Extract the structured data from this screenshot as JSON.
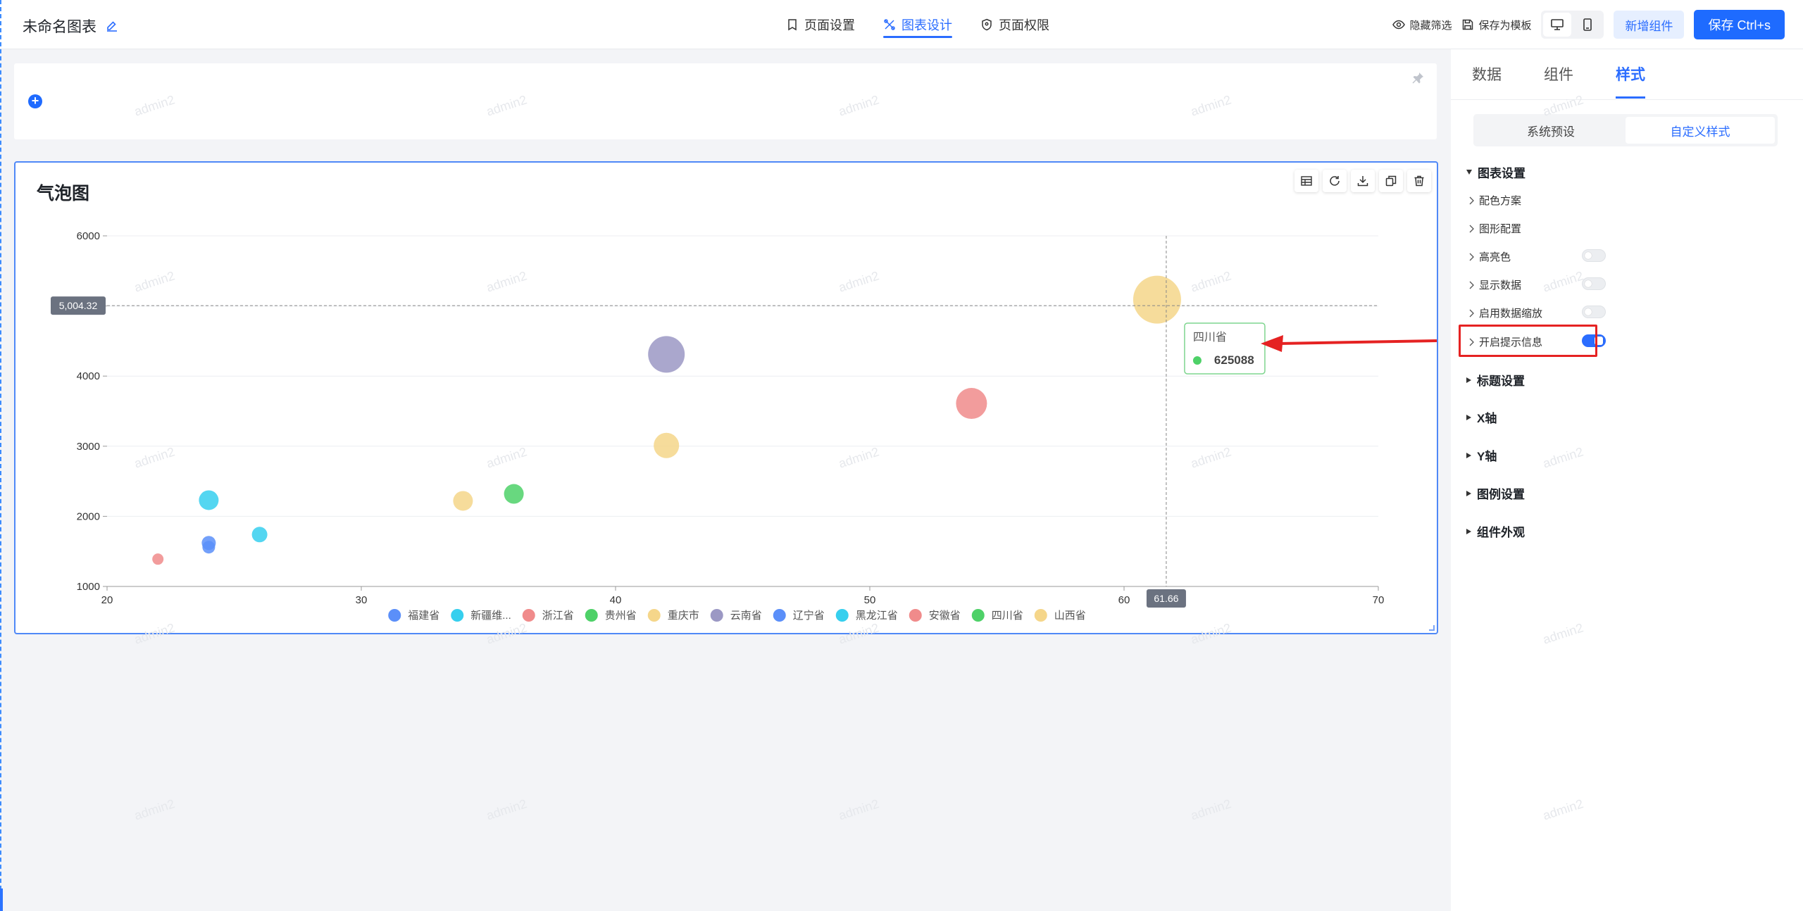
{
  "header": {
    "title": "未命名图表",
    "nav": [
      {
        "label": "页面设置",
        "icon": "bookmark-icon",
        "active": false
      },
      {
        "label": "图表设计",
        "icon": "design-icon",
        "active": true
      },
      {
        "label": "页面权限",
        "icon": "shield-icon",
        "active": false
      }
    ],
    "hide_filter": "隐藏筛选",
    "save_template": "保存为模板",
    "add_component": "新增组件",
    "save": "保存 Ctrl+s"
  },
  "watermark_text": "admin2",
  "chart_card": {
    "title": "气泡图",
    "tools": [
      "table-icon",
      "refresh-icon",
      "download-icon",
      "copy-icon",
      "delete-icon"
    ]
  },
  "chart_data": {
    "type": "scatter",
    "title": "气泡图",
    "xlim": [
      20,
      70
    ],
    "ylim": [
      1000,
      6000
    ],
    "x_ticks": [
      "20",
      "30",
      "40",
      "50",
      "60",
      "70"
    ],
    "y_ticks": [
      "1000",
      "2000",
      "3000",
      "4000",
      "5000",
      "6000"
    ],
    "grid": true,
    "legend_position": "bottom",
    "series": [
      {
        "name": "福建省",
        "color": "#5b8ff9",
        "points": [
          {
            "x": 24,
            "y": 1620,
            "size": 10
          },
          {
            "x": 24,
            "y": 1560,
            "size": 9
          }
        ]
      },
      {
        "name": "新疆维...",
        "color": "#36cfee",
        "points": [
          {
            "x": 24,
            "y": 2230,
            "size": 14
          },
          {
            "x": 26,
            "y": 1740,
            "size": 11
          }
        ]
      },
      {
        "name": "浙江省",
        "color": "#f08b8b",
        "points": [
          {
            "x": 22,
            "y": 1390,
            "size": 8
          }
        ]
      },
      {
        "name": "贵州省",
        "color": "#4ed168",
        "points": [
          {
            "x": 36,
            "y": 2320,
            "size": 14
          }
        ]
      },
      {
        "name": "重庆市",
        "color": "#f5d68a",
        "points": [
          {
            "x": 34,
            "y": 2220,
            "size": 14
          },
          {
            "x": 42,
            "y": 3010,
            "size": 18
          }
        ]
      },
      {
        "name": "云南省",
        "color": "#9b98c4",
        "points": [
          {
            "x": 42,
            "y": 4310,
            "size": 26
          }
        ]
      },
      {
        "name": "辽宁省",
        "color": "#5b8ff9",
        "points": []
      },
      {
        "name": "黑龙江省",
        "color": "#36cfee",
        "points": []
      },
      {
        "name": "安徽省",
        "color": "#f08b8b",
        "points": [
          {
            "x": 54,
            "y": 3610,
            "size": 22
          }
        ]
      },
      {
        "name": "四川省",
        "color": "#4ed168",
        "points": []
      },
      {
        "name": "山西省",
        "color": "#f5d68a",
        "points": [
          {
            "x": 61.3,
            "y": 5090,
            "size": 34
          }
        ]
      }
    ],
    "crosshair": {
      "x_label": "61.66",
      "y_label": "5,004.32"
    },
    "tooltip": {
      "title": "四川省",
      "value": "625088",
      "dot_color": "#4ed168"
    }
  },
  "right_panel": {
    "tabs": [
      {
        "label": "数据",
        "active": false
      },
      {
        "label": "组件",
        "active": false
      },
      {
        "label": "样式",
        "active": true
      }
    ],
    "segments": [
      {
        "label": "系统预设",
        "active": false
      },
      {
        "label": "自定义样式",
        "active": true
      }
    ],
    "chart_settings": {
      "title": "图表设置",
      "options": [
        {
          "label": "配色方案",
          "toggle": null
        },
        {
          "label": "图形配置",
          "toggle": null
        },
        {
          "label": "高亮色",
          "toggle": false
        },
        {
          "label": "显示数据",
          "toggle": false
        },
        {
          "label": "启用数据缩放",
          "toggle": false
        },
        {
          "label": "开启提示信息",
          "toggle": true
        }
      ]
    },
    "sections": [
      "标题设置",
      "X轴",
      "Y轴",
      "图例设置",
      "组件外观"
    ]
  }
}
